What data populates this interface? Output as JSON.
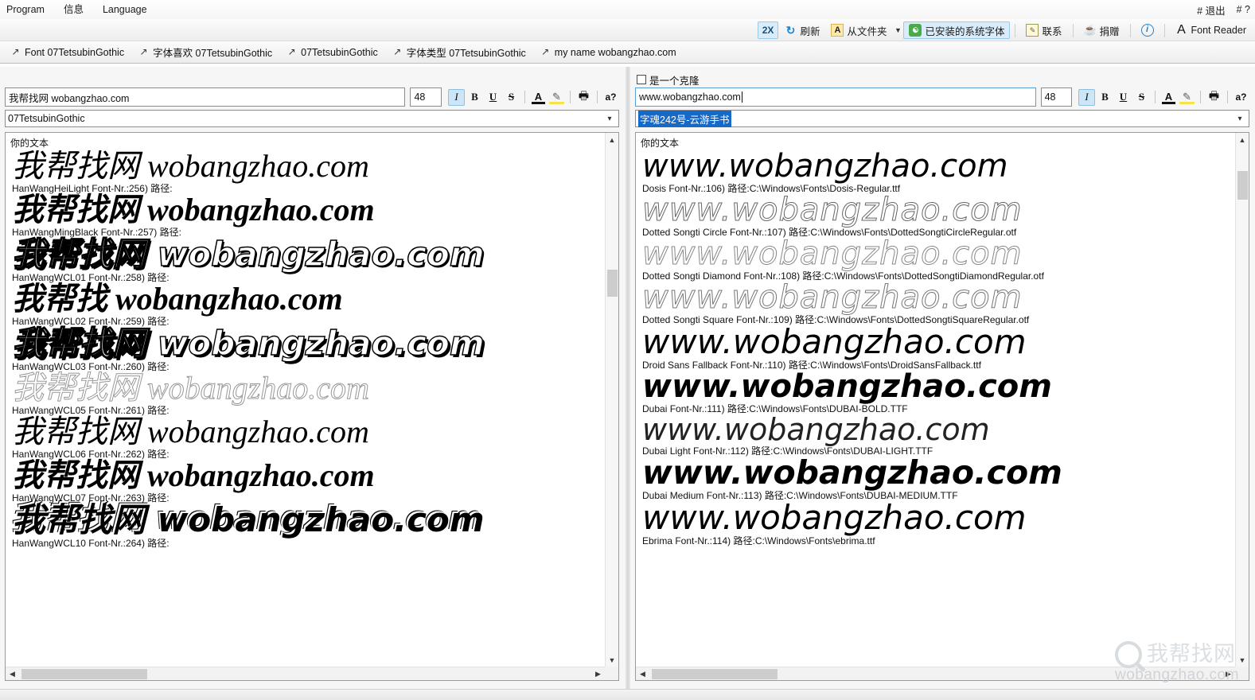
{
  "menubar": {
    "items": [
      {
        "label": "Program"
      },
      {
        "label": "信息"
      },
      {
        "label": "Language"
      }
    ],
    "right": [
      {
        "label": "# 退出"
      },
      {
        "label": "# ?"
      }
    ]
  },
  "toolbar": {
    "zoom_label": "2X",
    "refresh_label": "刷新",
    "from_folder_label": "从文件夹",
    "installed_fonts_label": "已安装的系统字体",
    "contact_label": "联系",
    "donate_label": "捐赠",
    "info_label": "",
    "app_name": "Font Reader",
    "icons": {
      "zoom": "zoom-2x-icon",
      "refresh": "refresh-icon",
      "folder": "folder-letter-a-icon",
      "dropdown": "chevron-down-icon",
      "installed": "installed-fonts-icon",
      "contact": "contact-note-icon",
      "donate": "coffee-cup-icon",
      "info": "info-circle-icon",
      "reader": "letter-a-icon"
    }
  },
  "tabs": [
    {
      "label": "Font 07TetsubinGothic"
    },
    {
      "label": "字体喜欢 07TetsubinGothic"
    },
    {
      "label": "07TetsubinGothic"
    },
    {
      "label": "字体类型 07TetsubinGothic"
    },
    {
      "label": "my name wobangzhao.com"
    }
  ],
  "left_panel": {
    "sample_text": "我帮找网 wobangzhao.com",
    "font_size": "48",
    "font_combo_value": "07TetsubinGothic",
    "list_header": "你的文本",
    "format_buttons": [
      {
        "name": "italic-button",
        "label": "I",
        "active": true
      },
      {
        "name": "bold-button",
        "label": "B",
        "active": false
      },
      {
        "name": "underline-button",
        "label": "U",
        "active": false
      },
      {
        "name": "strikethrough-button",
        "label": "S",
        "active": false
      },
      {
        "name": "font-color-button",
        "label": "A",
        "active": false
      },
      {
        "name": "highlight-color-button",
        "label": "✎",
        "active": false
      },
      {
        "name": "print-button",
        "label": "🖶",
        "active": false
      },
      {
        "name": "about-font-button",
        "label": "a?",
        "active": false
      }
    ],
    "fonts": [
      {
        "sample": "我帮找网 wobangzhao.com",
        "meta": "HanWangHeiLight Font-Nr.:256) 路径:"
      },
      {
        "sample": "我帮找网 wobangzhao.com",
        "meta": "HanWangMingBlack Font-Nr.:257) 路径:"
      },
      {
        "sample": "我帮找网 wobangzhao.com",
        "meta": "HanWangWCL01 Font-Nr.:258) 路径:"
      },
      {
        "sample": "我帮找 wobangzhao.com",
        "meta": "HanWangWCL02 Font-Nr.:259) 路径:"
      },
      {
        "sample": "我帮找网 wobangzhao.com",
        "meta": "HanWangWCL03 Font-Nr.:260) 路径:"
      },
      {
        "sample": "我帮找网 wobangzhao.com",
        "meta": "HanWangWCL05 Font-Nr.:261) 路径:"
      },
      {
        "sample": "我帮找网 wobangzhao.com",
        "meta": "HanWangWCL06 Font-Nr.:262) 路径:"
      },
      {
        "sample": "我帮找网 wobangzhao.com",
        "meta": "HanWangWCL07 Font-Nr.:263) 路径:"
      },
      {
        "sample": "我帮找网 wobangzhao.com",
        "meta": "HanWangWCL10 Font-Nr.:264) 路径:"
      }
    ]
  },
  "right_panel": {
    "clone_checkbox_label": "是一个克隆",
    "clone_checked": false,
    "sample_text": "www.wobangzhao.com",
    "font_size": "48",
    "font_combo_value": "字魂242号-云游手书",
    "list_header": "你的文本",
    "format_buttons": [
      {
        "name": "italic-button",
        "label": "I",
        "active": true
      },
      {
        "name": "bold-button",
        "label": "B",
        "active": false
      },
      {
        "name": "underline-button",
        "label": "U",
        "active": false
      },
      {
        "name": "strikethrough-button",
        "label": "S",
        "active": false
      },
      {
        "name": "font-color-button",
        "label": "A",
        "active": false
      },
      {
        "name": "highlight-color-button",
        "label": "✎",
        "active": false
      },
      {
        "name": "print-button",
        "label": "🖶",
        "active": false
      },
      {
        "name": "about-font-button",
        "label": "a?",
        "active": false
      }
    ],
    "fonts": [
      {
        "sample": "www.wobangzhao.com",
        "meta": "Dosis Font-Nr.:106) 路径:C:\\Windows\\Fonts\\Dosis-Regular.ttf"
      },
      {
        "sample": "www.wobangzhao.com",
        "meta": "Dotted Songti Circle Font-Nr.:107) 路径:C:\\Windows\\Fonts\\DottedSongtiCircleRegular.otf"
      },
      {
        "sample": "www.wobangzhao.com",
        "meta": "Dotted Songti Diamond Font-Nr.:108) 路径:C:\\Windows\\Fonts\\DottedSongtiDiamondRegular.otf"
      },
      {
        "sample": "www.wobangzhao.com",
        "meta": "Dotted Songti Square Font-Nr.:109) 路径:C:\\Windows\\Fonts\\DottedSongtiSquareRegular.otf"
      },
      {
        "sample": "www.wobangzhao.com",
        "meta": "Droid Sans Fallback Font-Nr.:110) 路径:C:\\Windows\\Fonts\\DroidSansFallback.ttf"
      },
      {
        "sample": "www.wobangzhao.com",
        "meta": "Dubai Font-Nr.:111) 路径:C:\\Windows\\Fonts\\DUBAI-BOLD.TTF"
      },
      {
        "sample": "www.wobangzhao.com",
        "meta": "Dubai Light Font-Nr.:112) 路径:C:\\Windows\\Fonts\\DUBAI-LIGHT.TTF"
      },
      {
        "sample": "www.wobangzhao.com",
        "meta": "Dubai Medium Font-Nr.:113) 路径:C:\\Windows\\Fonts\\DUBAI-MEDIUM.TTF"
      },
      {
        "sample": "www.wobangzhao.com",
        "meta": "Ebrima Font-Nr.:114) 路径:C:\\Windows\\Fonts\\ebrima.ttf"
      }
    ]
  },
  "watermark": {
    "cn": "我帮找网",
    "url": "wobangzhao.com"
  },
  "colors": {
    "accent": "#d8ecfb",
    "accent_border": "#9cc9e8",
    "selection": "#1769c8",
    "window_bg": "#f6f6f6"
  }
}
